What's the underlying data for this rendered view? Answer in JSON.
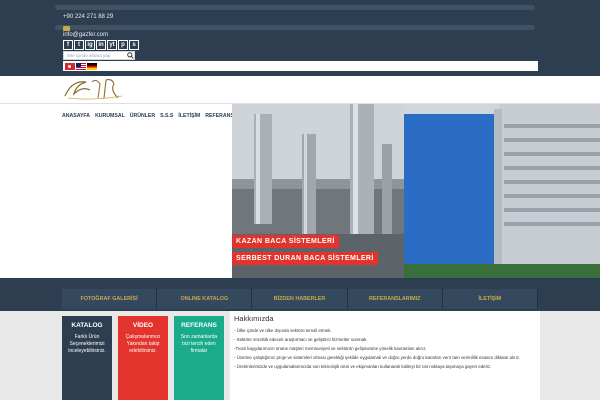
{
  "topbar": {
    "phone": "+90 224 271 88 29",
    "email": "info@gazfer.com",
    "social": [
      "f",
      "t",
      "ig",
      "in",
      "yt",
      "p",
      "s"
    ],
    "search_placeholder": "Site içinde arama yap"
  },
  "nav": {
    "items": [
      "ANASAYFA",
      "KURUMSAL",
      "ÜRÜNLER",
      "S.S.S",
      "İLETİŞİM",
      "REFERANSLAR"
    ]
  },
  "slider": {
    "captions": [
      "KAZAN BACA SİSTEMLERİ",
      "SERBEST DURAN BACA SİSTEMLERİ"
    ]
  },
  "tabs": [
    "FOTOĞRAF GALERİSİ",
    "ONLINE KATALOG",
    "BİZDEN HABERLER",
    "REFERANSLARIMIZ",
    "İLETİŞİM"
  ],
  "cards": [
    {
      "title": "KATALOG",
      "body": "Farklı Ürün Seçeneklerimizi inceleyebilirsiniz.",
      "color": "#2c3e50"
    },
    {
      "title": "VİDEO",
      "body": "Çalışmalarımızı Yakından takip edebilirsiniz.",
      "color": "#e2332c"
    },
    {
      "title": "REFERANS",
      "body": "Son zamanlarda bizi tercih eden firmalar",
      "color": "#1aab8a"
    }
  ],
  "about": {
    "title": "Hakkımızda",
    "paragraphs": [
      "- Ülke içinde ve ülke dışında sektörü temsil etmek.",
      "- Sektöre öncülük edecek araştırmacı ve geliştirici hizmetler sunmak.",
      "-Ticari kaygılarımızın önüne müşteri memnuniyeti ve sektörün gelişmesine yönelik kavramları alırız.",
      "- Üzerine çalıştığımız proje ve sistemleri olması gerektiği şekilde uygulamak ve doğru yerde doğru kararları verir tam verimlilik esasını dikkate alırız.",
      "- Üretimlerimizde ve uygulamalarımızda son teknolojik ürün ve ekipmanları kullanarak kaliteyi bir üst noktaya taşımaya gayret ederiz."
    ]
  },
  "colors": {
    "navy": "#2c3e50",
    "gold": "#c9a94c",
    "red": "#e2332c",
    "teal": "#1aab8a"
  }
}
